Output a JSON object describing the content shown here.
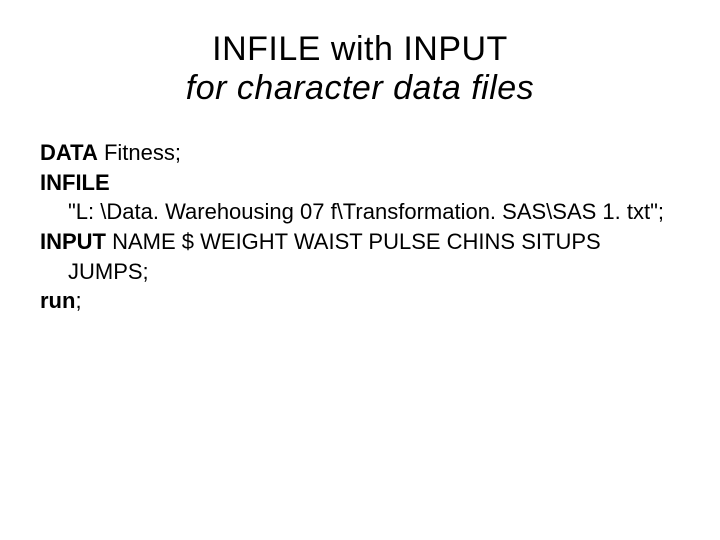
{
  "title": {
    "line1": "INFILE with INPUT",
    "line2": "for character data files"
  },
  "code": {
    "data_kw": "DATA",
    "data_rest": " Fitness;",
    "infile_kw": "INFILE",
    "infile_path": "\"L: \\Data. Warehousing 07 f\\Transformation. SAS\\SAS 1. txt\";",
    "input_kw": "INPUT",
    "input_rest": " NAME $ WEIGHT WAIST PULSE CHINS SITUPS",
    "input_cont": "JUMPS;",
    "run_kw": "run",
    "run_semi": ";"
  }
}
